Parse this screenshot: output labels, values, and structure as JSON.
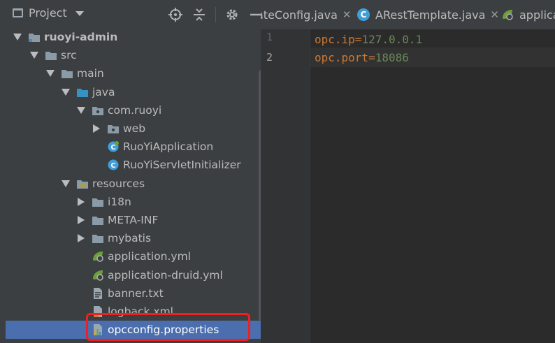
{
  "project_panel": {
    "title": "Project",
    "tree": [
      {
        "label": "ruoyi-admin",
        "icon": "module-folder-icon",
        "expanded": true,
        "bold": true
      },
      {
        "label": "src",
        "icon": "folder-icon",
        "expanded": true
      },
      {
        "label": "main",
        "icon": "folder-icon",
        "expanded": true
      },
      {
        "label": "java",
        "icon": "source-root-folder-icon",
        "expanded": true
      },
      {
        "label": "com.ruoyi",
        "icon": "package-icon",
        "expanded": true
      },
      {
        "label": "web",
        "icon": "package-icon",
        "expanded": false
      },
      {
        "label": "RuoYiApplication",
        "icon": "spring-boot-class-icon"
      },
      {
        "label": "RuoYiServletInitializer",
        "icon": "class-icon"
      },
      {
        "label": "resources",
        "icon": "resources-folder-icon",
        "expanded": true
      },
      {
        "label": "i18n",
        "icon": "folder-icon",
        "expanded": false
      },
      {
        "label": "META-INF",
        "icon": "folder-icon",
        "expanded": false
      },
      {
        "label": "mybatis",
        "icon": "folder-icon",
        "expanded": false
      },
      {
        "label": "application.yml",
        "icon": "spring-config-icon"
      },
      {
        "label": "application-druid.yml",
        "icon": "spring-config-icon"
      },
      {
        "label": "banner.txt",
        "icon": "text-file-icon"
      },
      {
        "label": "logback.xml",
        "icon": "xml-file-icon"
      },
      {
        "label": "opcconfig.properties",
        "icon": "properties-file-icon",
        "selected": true
      }
    ]
  },
  "editor": {
    "tabs": [
      {
        "label": "ateConfig.java",
        "icon": "none"
      },
      {
        "label": "ARestTemplate.java",
        "icon": "class-icon"
      },
      {
        "label": "applica",
        "icon": "spring-config-icon"
      }
    ],
    "lines": [
      {
        "number": "1",
        "key": "opc.ip",
        "eq": "=",
        "value": "127.0.0.1"
      },
      {
        "number": "2",
        "key": "opc.port",
        "eq": "=",
        "value": "18086"
      }
    ]
  },
  "colors": {
    "selection": "#4b6eaf",
    "highlight_box": "#ee2020",
    "property_key": "#cc7832",
    "property_value": "#6a8759"
  }
}
